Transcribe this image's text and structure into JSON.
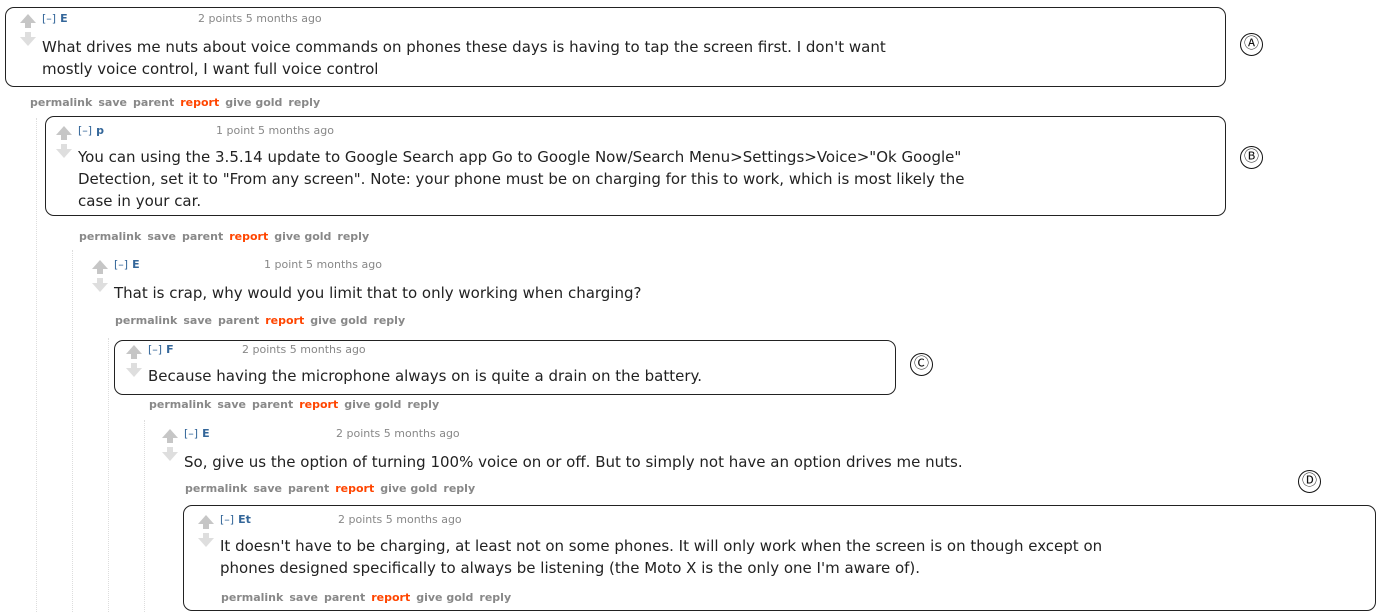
{
  "comments": [
    {
      "expand": "[–]",
      "author": "E",
      "meta": "2 points 5 months ago",
      "lines": [
        "What drives me nuts about voice commands on phones these days is having to tap the screen first. I don't want",
        "mostly voice control, I want full voice control"
      ]
    },
    {
      "expand": "[–]",
      "author": "p",
      "meta": "1 point 5 months ago",
      "lines": [
        "You can using the 3.5.14 update to Google Search app Go to Google Now/Search Menu>Settings>Voice>\"Ok Google\"",
        "Detection, set it to \"From any screen\". Note: your phone must be on charging for this to work, which is most likely the",
        "case in your car."
      ]
    },
    {
      "expand": "[–]",
      "author": "E",
      "meta": "1 point 5 months ago",
      "lines": [
        "That is crap, why would you limit that to only working when charging?"
      ]
    },
    {
      "expand": "[–]",
      "author": "F",
      "meta": "2 points 5 months ago",
      "lines": [
        "Because having the microphone always on is quite a drain on the battery."
      ]
    },
    {
      "expand": "[–]",
      "author": "E",
      "meta": "2 points 5 months ago",
      "lines": [
        "So, give us the option of turning 100% voice on or off. But to simply not have an option drives me nuts."
      ]
    },
    {
      "expand": "[–]",
      "author": "Et",
      "meta": "2 points 5 months ago",
      "lines": [
        "It doesn't have to be charging, at least not on some phones. It will only work when the screen is on though except on",
        "phones designed specifically to always be listening (the Moto X is the only one I'm aware of)."
      ]
    }
  ],
  "buttons": {
    "permalink": "permalink",
    "save": "save",
    "parent": "parent",
    "report": "report",
    "give_gold": "give gold",
    "reply": "reply"
  },
  "callouts": {
    "a": "Ⓐ",
    "b": "Ⓑ",
    "c": "Ⓒ",
    "d": "Ⓓ"
  },
  "colors": {
    "author": "#336699",
    "report": "#ff4500",
    "meta": "#888888"
  }
}
